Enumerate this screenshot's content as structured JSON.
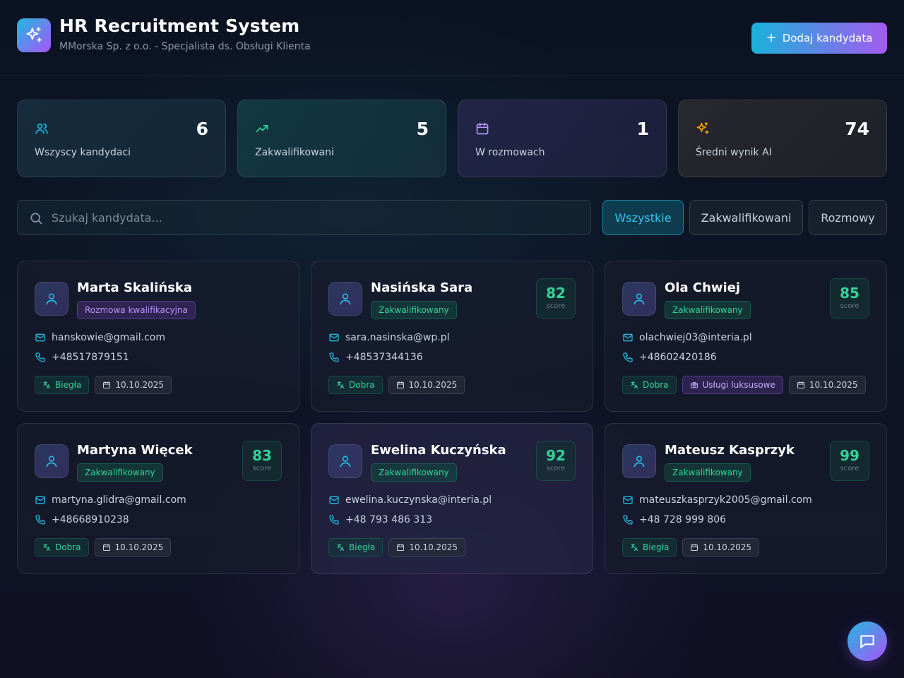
{
  "header": {
    "title": "HR Recruitment System",
    "subtitle": "MMorska Sp. z o.o. - Specjalista ds. Obsługi Klienta",
    "add_button": "Dodaj kandydata"
  },
  "stats": [
    {
      "value": "6",
      "label": "Wszyscy kandydaci",
      "icon": "users-icon",
      "color": "#22b8e0"
    },
    {
      "value": "5",
      "label": "Zakwalifikowani",
      "icon": "trending-up-icon",
      "color": "#34d399"
    },
    {
      "value": "1",
      "label": "W rozmowach",
      "icon": "calendar-icon",
      "color": "#b794f6"
    },
    {
      "value": "74",
      "label": "Średni wynik AI",
      "icon": "sparkles-icon",
      "color": "#f59e0b"
    }
  ],
  "search": {
    "placeholder": "Szukaj kandydata..."
  },
  "filters": [
    {
      "label": "Wszystkie",
      "active": true
    },
    {
      "label": "Zakwalifikowani",
      "active": false
    },
    {
      "label": "Rozmowy",
      "active": false
    }
  ],
  "candidates": [
    {
      "name": "Marta Skalińska",
      "status": "Rozmowa kwalifikacyjna",
      "score": null,
      "email": "hanskowie@gmail.com",
      "phone": "+48517879151",
      "language": "Biegła",
      "date": "10.10.2025"
    },
    {
      "name": "Nasińska Sara",
      "status": "Zakwalifikowany",
      "score": "82",
      "email": "sara.nasinska@wp.pl",
      "phone": "+48537344136",
      "language": "Dobra",
      "date": "10.10.2025"
    },
    {
      "name": "Ola Chwiej",
      "status": "Zakwalifikowany",
      "score": "85",
      "email": "olachwiej03@interia.pl",
      "phone": "+48602420186",
      "language": "Dobra",
      "extra_tag": "Usługi luksusowe",
      "date": "10.10.2025"
    },
    {
      "name": "Martyna Więcek",
      "status": "Zakwalifikowany",
      "score": "83",
      "email": "martyna.glidra@gmail.com",
      "phone": "+48668910238",
      "language": "Dobra",
      "date": "10.10.2025"
    },
    {
      "name": "Ewelina Kuczyńska",
      "status": "Zakwalifikowany",
      "score": "92",
      "email": "ewelina.kuczynska@interia.pl",
      "phone": "+48 793 486 313",
      "language": "Biegła",
      "date": "10.10.2025"
    },
    {
      "name": "Mateusz Kasprzyk",
      "status": "Zakwalifikowany",
      "score": "99",
      "email": "mateuszkasprzyk2005@gmail.com",
      "phone": "+48 728 999 806",
      "language": "Biegła",
      "date": "10.10.2025"
    }
  ],
  "score_label": "score"
}
